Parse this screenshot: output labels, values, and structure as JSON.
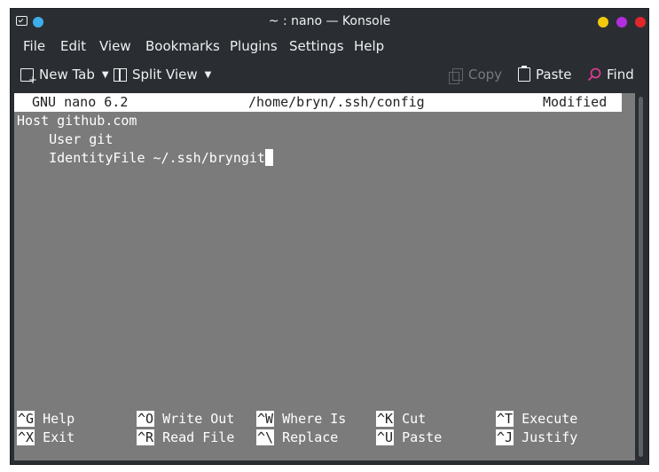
{
  "window": {
    "title": "~ : nano — Konsole",
    "buttons": {
      "minimize": "#f2c80d",
      "maximize": "#b32de0",
      "close": "#e0272c"
    }
  },
  "menubar": [
    "File",
    "Edit",
    "View",
    "Bookmarks",
    "Plugins",
    "Settings",
    "Help"
  ],
  "toolbar": {
    "new_tab": "New Tab",
    "split_view": "Split View",
    "copy": "Copy",
    "paste": "Paste",
    "find": "Find"
  },
  "nano": {
    "version": "GNU nano 6.2",
    "file_path": "/home/bryn/.ssh/config",
    "status": "Modified",
    "lines": [
      "Host github.com",
      "    User git",
      "    IdentityFile ~/.ssh/bryngit"
    ],
    "shortcuts_row1": [
      {
        "key": "^G",
        "label": "Help"
      },
      {
        "key": "^O",
        "label": "Write Out"
      },
      {
        "key": "^W",
        "label": "Where Is"
      },
      {
        "key": "^K",
        "label": "Cut"
      },
      {
        "key": "^T",
        "label": "Execute"
      }
    ],
    "shortcuts_row2": [
      {
        "key": "^X",
        "label": "Exit"
      },
      {
        "key": "^R",
        "label": "Read File"
      },
      {
        "key": "^\\",
        "label": "Replace"
      },
      {
        "key": "^U",
        "label": "Paste"
      },
      {
        "key": "^J",
        "label": "Justify"
      }
    ]
  },
  "colors": {
    "accent": "#3daee9",
    "terminal_bg": "#7b7b7b",
    "window_bg": "#2a2e32",
    "find_icon": "#e93a9a"
  }
}
